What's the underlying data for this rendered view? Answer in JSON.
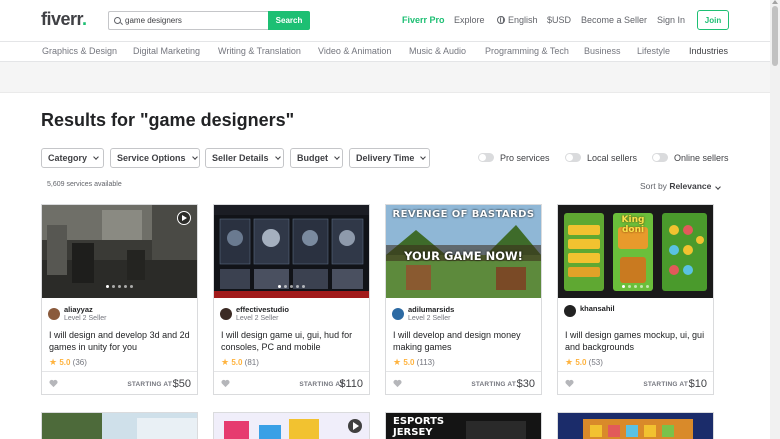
{
  "header": {
    "logo": "fiverr",
    "logo_dot": ".",
    "search_value": "game designers",
    "search_button": "Search",
    "fiverr_pro": "Fiverr Pro",
    "explore": "Explore",
    "language": "English",
    "currency": "$USD",
    "become_seller": "Become a Seller",
    "sign_in": "Sign In",
    "join": "Join"
  },
  "categories": [
    "Graphics & Design",
    "Digital Marketing",
    "Writing & Translation",
    "Video & Animation",
    "Music & Audio",
    "Programming & Tech",
    "Business",
    "Lifestyle",
    "Industries"
  ],
  "results": {
    "title": "Results for \"game designers\"",
    "count": "5,609 services available"
  },
  "filters": [
    "Category",
    "Service Options",
    "Seller Details",
    "Budget",
    "Delivery Time"
  ],
  "toggles": [
    "Pro services",
    "Local sellers",
    "Online sellers"
  ],
  "sort": {
    "label": "Sort by",
    "value": "Relevance"
  },
  "gigs": [
    {
      "seller": "aliayyaz",
      "level": "Level 2 Seller",
      "title": "I will design and develop 3d and 2d games in unity for you",
      "rating": "5.0",
      "reviews": "(36)",
      "starting": "STARTING AT",
      "price": "$50",
      "avatar_color": "#8a5a3c"
    },
    {
      "seller": "effectivestudio",
      "level": "Level 2 Seller",
      "title": "I will design game ui, gui, hud for consoles, PC and mobile",
      "rating": "5.0",
      "reviews": "(81)",
      "starting": "STARTING AT",
      "price": "$110",
      "avatar_color": "#3b2a24"
    },
    {
      "seller": "adilumarsids",
      "level": "Level 2 Seller",
      "title": "I will develop and design money making games",
      "rating": "5.0",
      "reviews": "(113)",
      "starting": "STARTING AT",
      "price": "$30",
      "avatar_color": "#2d6aa3",
      "thumb_top_text": "REVENGE OF BASTARDS",
      "thumb_mid_text": "YOUR GAME NOW!"
    },
    {
      "seller": "khansahil",
      "level": "",
      "title": "I will design games mockup, ui, gui and backgrounds",
      "rating": "5.0",
      "reviews": "(53)",
      "starting": "STARTING AT",
      "price": "$10",
      "avatar_color": "#222222",
      "thumb_badge": "King doni"
    }
  ],
  "second_row": [
    {
      "thumb_text": ""
    },
    {
      "thumb_text": ""
    },
    {
      "thumb_text_1": "ESPORTS",
      "thumb_text_2": "JERSEY"
    },
    {
      "thumb_text": ""
    }
  ]
}
